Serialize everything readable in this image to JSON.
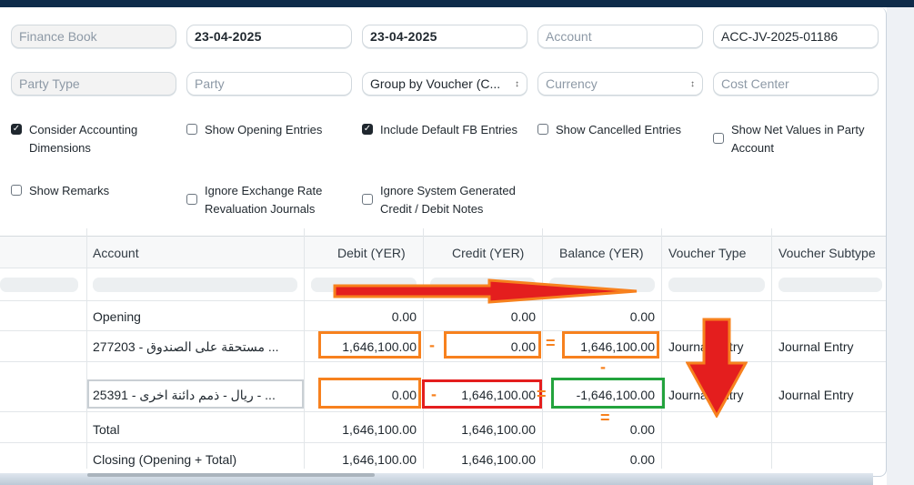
{
  "filters": {
    "row1": {
      "finance_book": "Finance Book",
      "from_date": "23-04-2025",
      "to_date": "23-04-2025",
      "account": "Account",
      "voucher_no": "ACC-JV-2025-01186"
    },
    "row2": {
      "party_type": "Party Type",
      "party": "Party",
      "group_by": "Group by Voucher (C...",
      "currency": "Currency",
      "cost_center": "Cost Center"
    }
  },
  "checkboxes": [
    {
      "label": "Consider Accounting Dimensions",
      "checked": true
    },
    {
      "label": "Show Opening Entries",
      "checked": false
    },
    {
      "label": "Include Default FB Entries",
      "checked": true
    },
    {
      "label": "Show Cancelled Entries",
      "checked": false
    },
    {
      "label": "Show Net Values in Party Account",
      "checked": false
    },
    {
      "label": "Show Remarks",
      "checked": false
    },
    {
      "label": "Ignore Exchange Rate Revaluation Journals",
      "checked": false
    },
    {
      "label": "Ignore System Generated Credit / Debit Notes",
      "checked": false
    }
  ],
  "table": {
    "columns": [
      "Account",
      "Debit (YER)",
      "Credit (YER)",
      "Balance (YER)",
      "Voucher Type",
      "Voucher Subtype"
    ],
    "rows": [
      {
        "account": "Opening",
        "debit": "0.00",
        "credit": "0.00",
        "balance": "0.00",
        "voucher_type": "",
        "voucher_subtype": ""
      },
      {
        "account": "277203 - مستحقة على الصندوق ...",
        "debit": "1,646,100.00",
        "credit": "0.00",
        "balance": "1,646,100.00",
        "voucher_type": "Journal Entry",
        "voucher_subtype": "Journal Entry"
      },
      {
        "account": "25391 - ريال - ذمم دائنة اخرى - ...",
        "debit": "0.00",
        "credit": "1,646,100.00",
        "balance": "-1,646,100.00",
        "voucher_type": "Journal Entry",
        "voucher_subtype": "Journal Entry"
      },
      {
        "account": "Total",
        "debit": "1,646,100.00",
        "credit": "1,646,100.00",
        "balance": "0.00",
        "voucher_type": "",
        "voucher_subtype": ""
      },
      {
        "account": "Closing (Opening + Total)",
        "debit": "1,646,100.00",
        "credit": "1,646,100.00",
        "balance": "0.00",
        "voucher_type": "",
        "voucher_subtype": ""
      }
    ]
  },
  "annotations": {
    "minus": "-",
    "equals": "=",
    "orange": "#f7811e",
    "red": "#e41e1e",
    "green": "#23a33d"
  }
}
